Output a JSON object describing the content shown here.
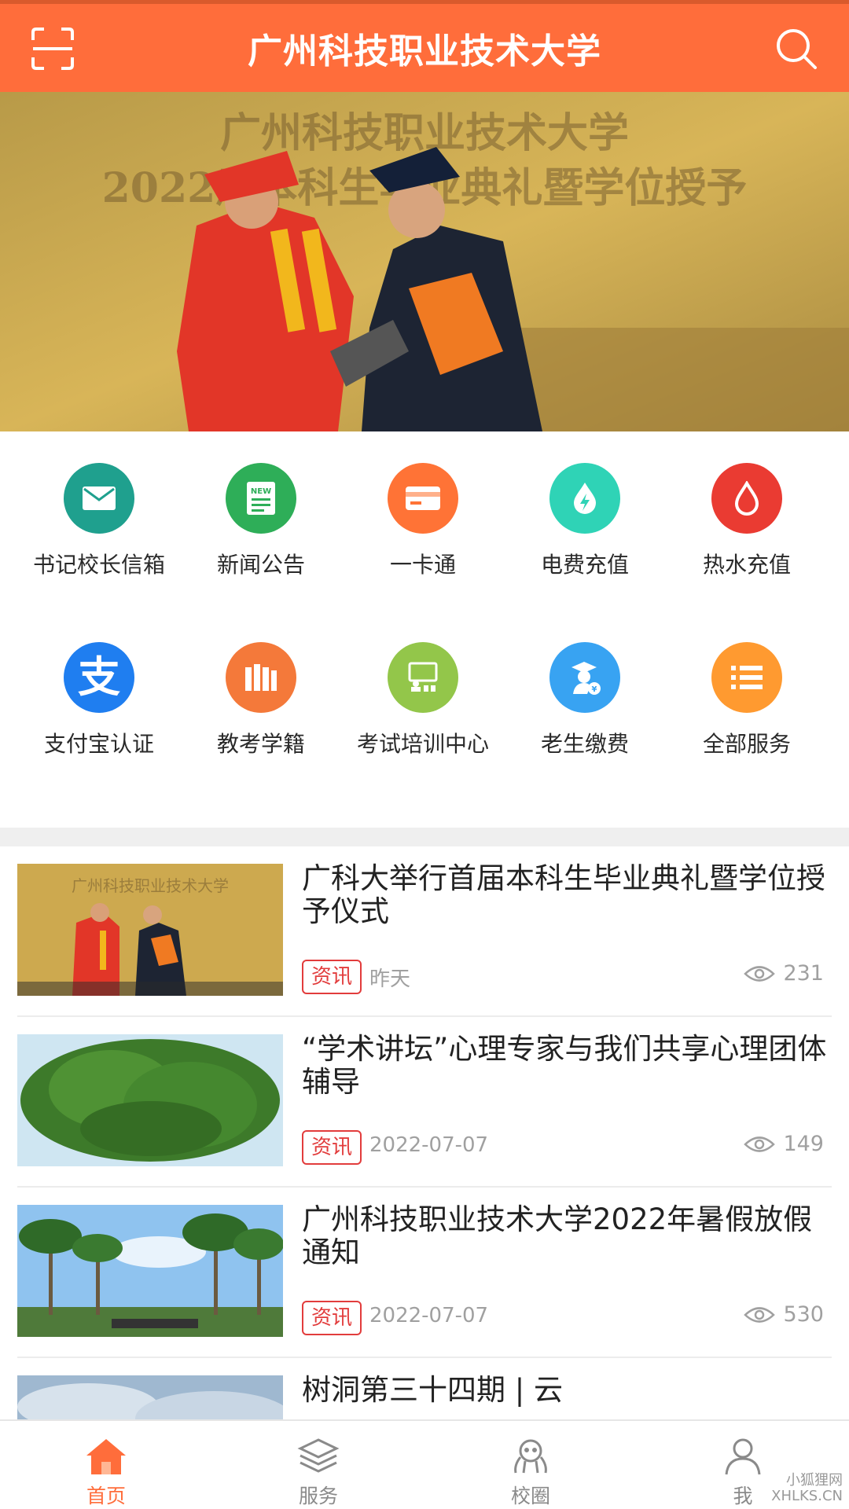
{
  "header": {
    "title": "广州科技职业技术大学"
  },
  "banner": {
    "line1": "广州科技职业技术大学",
    "line2": "2022届本科生毕业典礼暨学位授予"
  },
  "services": [
    {
      "label": "书记校长信箱",
      "icon": "mail-icon",
      "color": "#1fa08e"
    },
    {
      "label": "新闻公告",
      "icon": "news-icon",
      "color": "#2eae58"
    },
    {
      "label": "一卡通",
      "icon": "card-icon",
      "color": "#ff7336"
    },
    {
      "label": "电费充值",
      "icon": "electricity-icon",
      "color": "#2fd3b6"
    },
    {
      "label": "热水充值",
      "icon": "hot-water-icon",
      "color": "#ea3b32"
    },
    {
      "label": "支付宝认证",
      "icon": "alipay-icon",
      "color": "#1f7ef0"
    },
    {
      "label": "教考学籍",
      "icon": "books-icon",
      "color": "#f4793a"
    },
    {
      "label": "考试培训中心",
      "icon": "training-icon",
      "color": "#93c64a"
    },
    {
      "label": "老生缴费",
      "icon": "fee-icon",
      "color": "#38a3f2"
    },
    {
      "label": "全部服务",
      "icon": "list-icon",
      "color": "#ff9a30"
    }
  ],
  "news": [
    {
      "title": "广科大举行首届本科生毕业典礼暨学位授予仪式",
      "tag": "资讯",
      "date": "昨天",
      "views": "231",
      "thumb": "ceremony"
    },
    {
      "title": "“学术讲坛”心理专家与我们共享心理团体辅导",
      "tag": "资讯",
      "date": "2022-07-07",
      "views": "149",
      "thumb": "tree"
    },
    {
      "title": "广州科技职业技术大学2022年暑假放假通知",
      "tag": "资讯",
      "date": "2022-07-07",
      "views": "530",
      "thumb": "palms"
    },
    {
      "title": "树洞第三十四期 | 云",
      "tag": "",
      "date": "",
      "views": "",
      "thumb": "sky"
    }
  ],
  "tabs": [
    {
      "label": "首页",
      "icon": "home-icon",
      "active": true
    },
    {
      "label": "服务",
      "icon": "layers-icon",
      "active": false
    },
    {
      "label": "校圈",
      "icon": "campus-circle-icon",
      "active": false
    },
    {
      "label": "我",
      "icon": "user-icon",
      "active": false
    }
  ],
  "watermark": {
    "line1": "小狐狸网",
    "line2": "XHLKS.CN"
  },
  "colors": {
    "brand": "#ff6d3b",
    "tag": "#e23c3c",
    "muted": "#a0a0a0"
  }
}
